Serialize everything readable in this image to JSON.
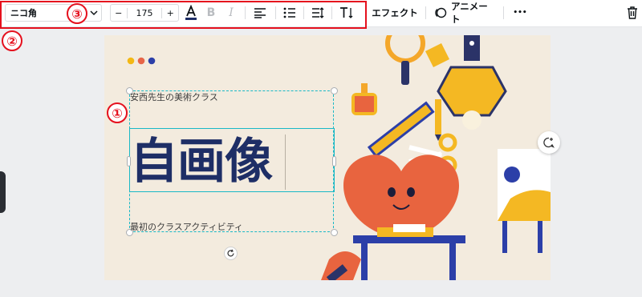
{
  "toolbar": {
    "font_name": "ニコ角",
    "font_size": "175",
    "minus": "−",
    "plus": "+",
    "bold": "B",
    "italic": "I",
    "effects_label": "エフェクト",
    "animate_label": "アニメート",
    "more": "•••"
  },
  "annotations": {
    "one": "①",
    "two": "②",
    "three": "③"
  },
  "canvas": {
    "subtitle_top": "安西先生の美術クラス",
    "title": "自画像",
    "subtitle_bottom": "最初のクラスアクティビティ"
  },
  "colors": {
    "accent_red": "#e5101d",
    "selection_teal": "#19b8c6",
    "title_navy": "#1e2e66",
    "canvas_bg": "#f3ebde"
  }
}
